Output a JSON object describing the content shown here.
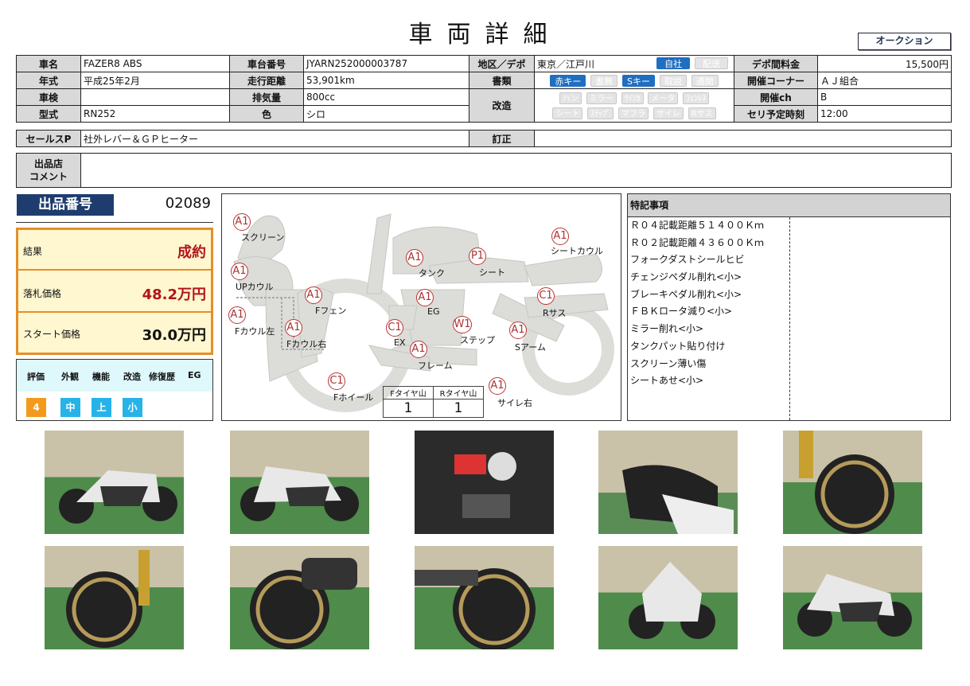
{
  "title": "車両詳細",
  "auction_button": "オークション",
  "info": {
    "name_label": "車名",
    "name": "FAZER8 ABS",
    "frame_label": "車台番号",
    "frame": "JYARN252000003787",
    "region_label": "地区／デポ",
    "region": "東京／江戸川",
    "transport_on": "自社",
    "transport_off": "配送",
    "depo_fee_label": "デポ間料金",
    "depo_fee": "15,500円",
    "year_label": "年式",
    "year": "平成25年2月",
    "mileage_label": "走行距離",
    "mileage": "53,901km",
    "docs_label": "書類",
    "docs_tags": [
      {
        "text": "赤キー",
        "on": true
      },
      {
        "text": "書無",
        "on": false
      },
      {
        "text": "Sキー",
        "on": true
      },
      {
        "text": "取説",
        "on": false
      },
      {
        "text": "通関",
        "on": false
      }
    ],
    "corner_label": "開催コーナー",
    "corner": "ＡＪ組合",
    "inspection_label": "車検",
    "inspection": "",
    "displacement_label": "排気量",
    "displacement": "800cc",
    "mod_label": "改造",
    "mod_tags_row1": [
      "ハン",
      "ミラー",
      "ｳｲﾝｶ",
      "メータ",
      "ﾌｪﾝﾚｽ"
    ],
    "mod_tags_row2": [
      "シート",
      "ｽﾃｯﾌﾟ",
      "マフラ",
      "サイレ",
      "Rサス"
    ],
    "channel_label": "開催ch",
    "channel": "B",
    "model_label": "型式",
    "model": "RN252",
    "color_label": "色",
    "color": "シロ",
    "schedule_label": "セリ予定時刻",
    "schedule": "12:00",
    "sales_label": "セールスP",
    "sales": "社外レバー＆ＧＰヒーター",
    "correction_label": "訂正",
    "correction": "",
    "comment_label_1": "出品店",
    "comment_label_2": "コメント",
    "comment": ""
  },
  "listing": {
    "number_label": "出品番号",
    "number": "02089",
    "result_label": "結果",
    "result": "成約",
    "winning_label": "落札価格",
    "winning": "48.2万円",
    "start_label": "スタート価格",
    "start": "30.0万円"
  },
  "evaluation": {
    "headers": [
      "評価",
      "外観",
      "機能",
      "改造",
      "修復歴",
      "EG"
    ],
    "values": [
      {
        "text": "4",
        "color": "#f39a1c"
      },
      {
        "text": "中",
        "color": "#27b3e8"
      },
      {
        "text": "上",
        "color": "#27b3e8"
      },
      {
        "text": "小",
        "color": "#27b3e8"
      }
    ]
  },
  "diagram": {
    "marks": [
      {
        "code": "A1",
        "part": "スクリーン"
      },
      {
        "code": "A1",
        "part": "UPカウル"
      },
      {
        "code": "A1",
        "part": "Fカウル左"
      },
      {
        "code": "A1",
        "part": "Fカウル右"
      },
      {
        "code": "A1",
        "part": "Fフェン"
      },
      {
        "code": "A1",
        "part": "タンク"
      },
      {
        "code": "P1",
        "part": "シート"
      },
      {
        "code": "A1",
        "part": "シートカウル"
      },
      {
        "code": "A1",
        "part": "EG"
      },
      {
        "code": "C1",
        "part": "Rサス"
      },
      {
        "code": "C1",
        "part": "EX"
      },
      {
        "code": "W1",
        "part": "ステップ"
      },
      {
        "code": "A1",
        "part": "Sアーム"
      },
      {
        "code": "A1",
        "part": "フレーム"
      },
      {
        "code": "C1",
        "part": "Fホイール"
      },
      {
        "code": "A1",
        "part": "サイレ右"
      }
    ],
    "tire_front_label": "Fタイヤ山",
    "tire_rear_label": "Rタイヤ山",
    "tire_front": "1",
    "tire_rear": "1"
  },
  "notes": {
    "header": "特記事項",
    "items": [
      "Ｒ０４記載距離５１４００Ｋｍ",
      "Ｒ０２記載距離４３６００Ｋｍ",
      "フォークダストシールヒビ",
      "チェンジペダル削れ<小>",
      "ブレーキペダル削れ<小>",
      "ＦＢＫロータ減り<小>",
      "ミラー削れ<小>",
      "タンクパット貼り付け",
      "スクリーン薄い傷",
      "シートあせ<小>"
    ]
  },
  "colors": {
    "accent_orange": "#e58e2a",
    "result_red": "#b3141b",
    "tag_blue": "#1f6ec2",
    "navy": "#1e3d6e"
  }
}
